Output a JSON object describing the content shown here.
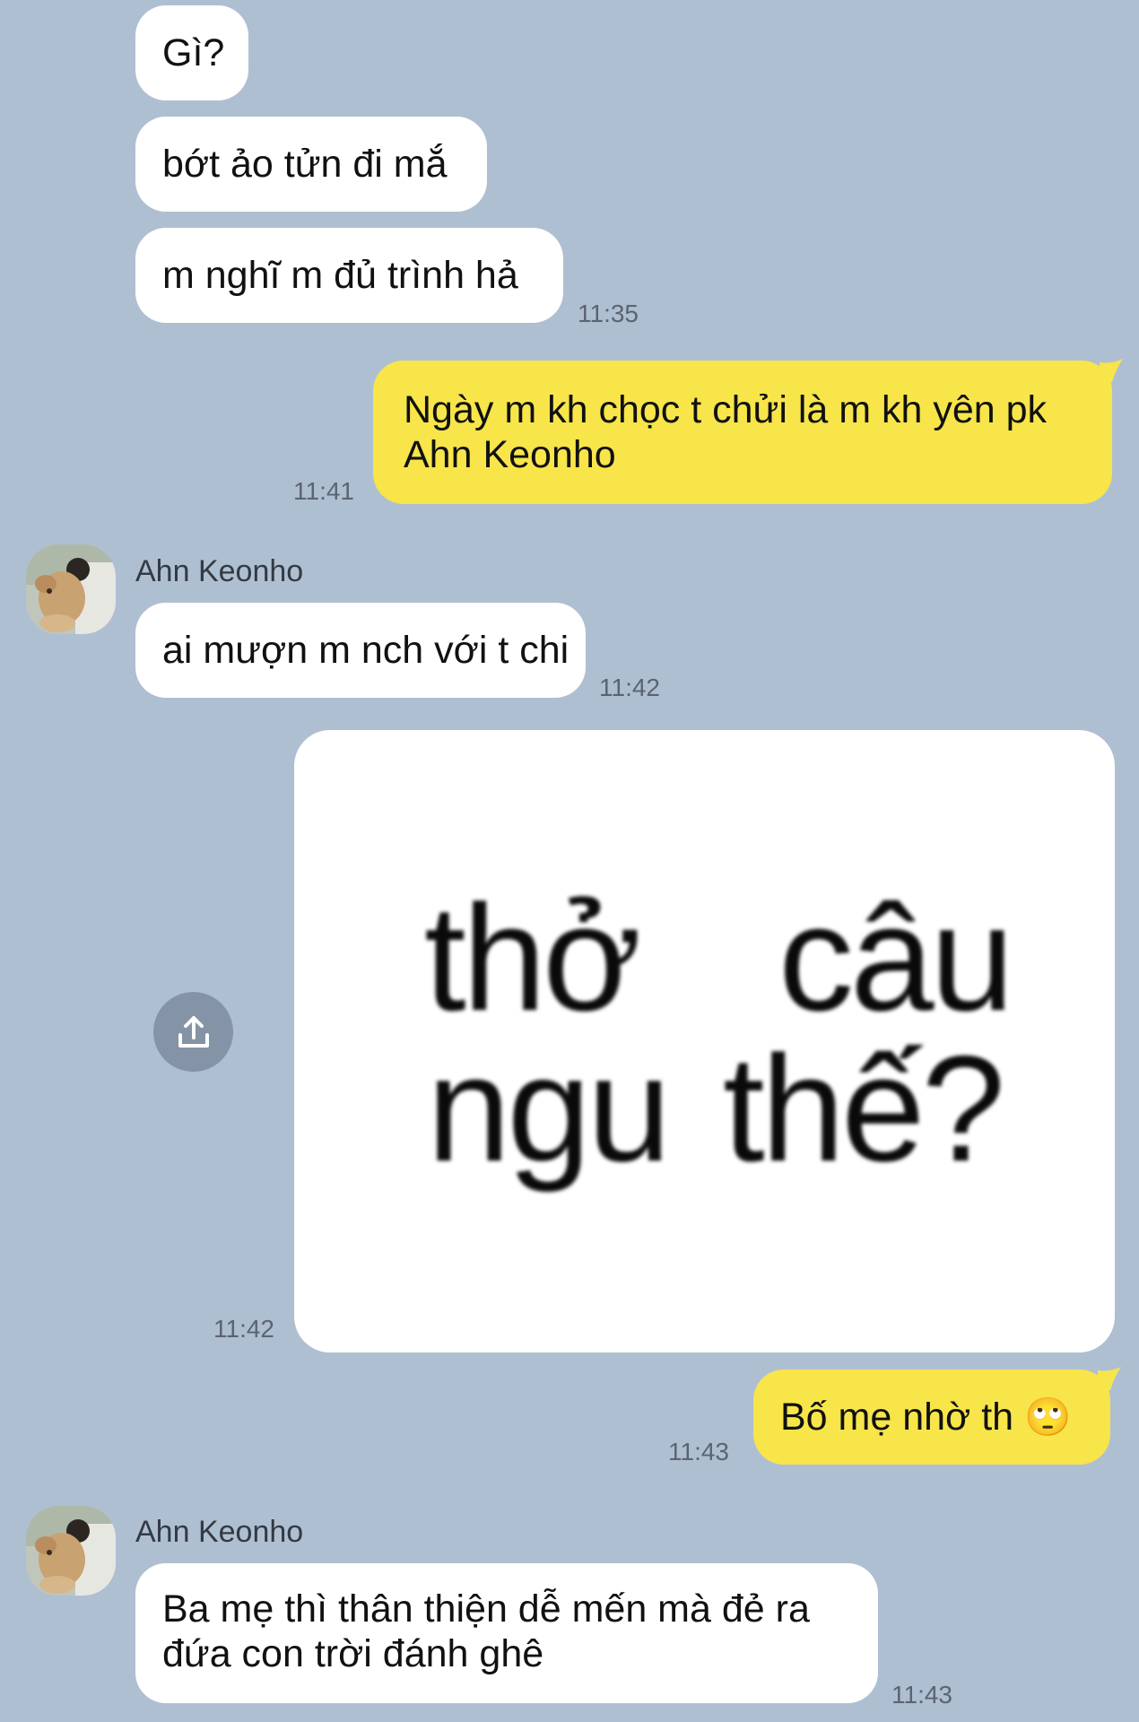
{
  "messages": {
    "m1": {
      "text": "Gì?"
    },
    "m2": {
      "text": "bớt ảo tửn đi mắ"
    },
    "m3": {
      "text": "m nghĩ m đủ trình hả",
      "time": "11:35"
    },
    "m4": {
      "text": "Ngày m kh chọc t chửi là m kh yên pk Ahn Keonho",
      "time": "11:41"
    },
    "m5": {
      "sender": "Ahn Keonho",
      "text": "ai mượn m nch với t chi",
      "time": "11:42"
    },
    "m6": {
      "image_text_line1_a": "thở",
      "image_text_line1_b": "câu",
      "image_text_line2_a": "ngu",
      "image_text_line2_b": "thế?",
      "time": "11:42"
    },
    "m7": {
      "text": "Bố mẹ nhờ th",
      "emoji": "🙄",
      "time": "11:43"
    },
    "m8": {
      "sender": "Ahn Keonho",
      "text": "Ba mẹ thì thân thiện dễ mến mà đẻ ra đứa con trời đánh ghê",
      "time": "11:43"
    }
  },
  "icons": {
    "share": "share-upload-icon",
    "avatar": "contact-avatar-photo"
  },
  "colors": {
    "background": "#afbfd2",
    "incoming": "#ffffff",
    "outgoing": "#f7e54a",
    "share_button": "#8593a6"
  }
}
